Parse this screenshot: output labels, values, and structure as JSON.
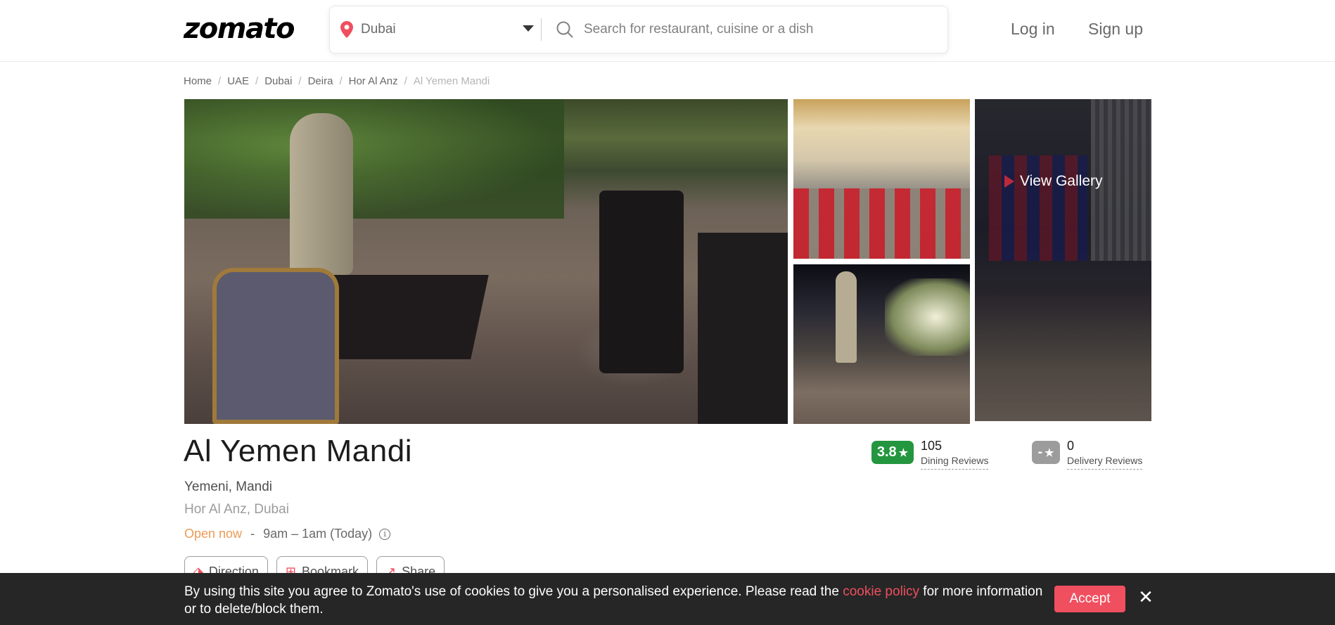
{
  "header": {
    "logo_text": "zomato",
    "location": "Dubai",
    "search_placeholder": "Search for restaurant, cuisine or a dish",
    "login_label": "Log in",
    "signup_label": "Sign up"
  },
  "breadcrumb": {
    "items": [
      "Home",
      "UAE",
      "Dubai",
      "Deira",
      "Hor Al Anz"
    ],
    "current": "Al Yemen Mandi",
    "separator": "/"
  },
  "gallery": {
    "view_gallery_label": "View Gallery"
  },
  "restaurant": {
    "name": "Al Yemen Mandi",
    "cuisines": "Yemeni, Mandi",
    "locality": "Hor Al Anz, Dubai",
    "open_status": "Open now",
    "dash": "-",
    "timing": "9am – 1am (Today)"
  },
  "ratings": {
    "dining": {
      "score": "3.8",
      "count": "105",
      "label": "Dining Reviews",
      "color": "#24963f"
    },
    "delivery": {
      "score": "-",
      "count": "0",
      "label": "Delivery Reviews",
      "color": "#9c9c9c"
    }
  },
  "actions": {
    "direction_label": "Direction",
    "bookmark_label": "Bookmark",
    "share_label": "Share"
  },
  "cookie_banner": {
    "text_before": "By using this site you agree to Zomato's use of cookies to give you a personalised experience. Please read the ",
    "link_text": "cookie policy",
    "text_after": " for more information or to delete/block them.",
    "accept_label": "Accept",
    "close_symbol": "✕"
  },
  "colors": {
    "brand_red": "#ef4f5f",
    "open_orange": "#ec9b55"
  }
}
